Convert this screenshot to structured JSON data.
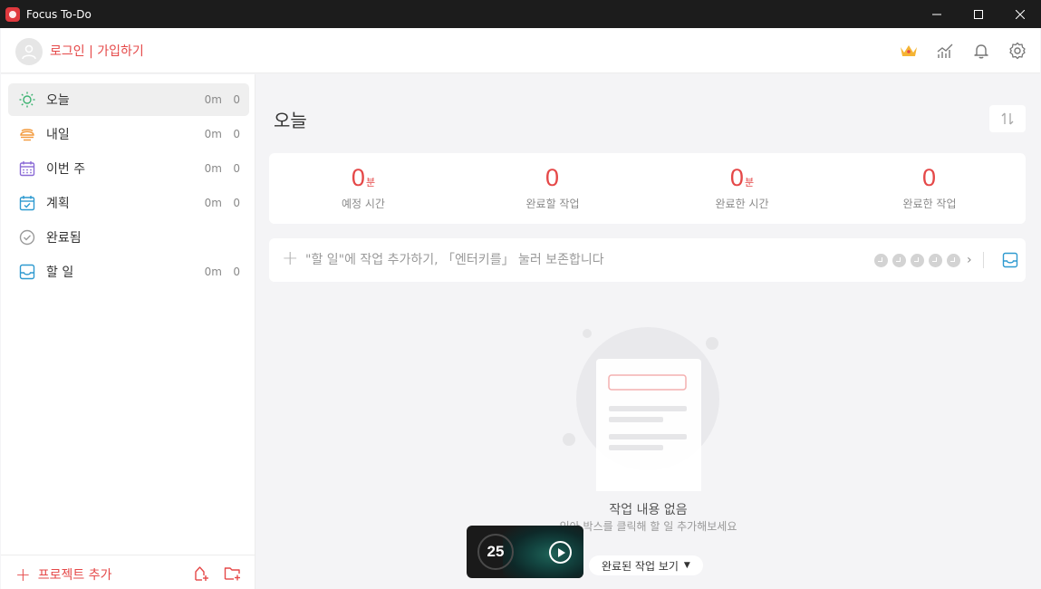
{
  "window": {
    "title": "Focus To-Do"
  },
  "header": {
    "login_label": "로그인 | 가입하기",
    "icons": [
      "crown-icon",
      "chart-icon",
      "bell-icon",
      "gear-icon"
    ]
  },
  "sidebar": {
    "items": [
      {
        "label": "오늘",
        "time": "0m",
        "count": "0",
        "icon": "sun-icon",
        "color": "#3cb371",
        "active": true
      },
      {
        "label": "내일",
        "time": "0m",
        "count": "0",
        "icon": "sunset-icon",
        "color": "#f39a3c",
        "active": false
      },
      {
        "label": "이번 주",
        "time": "0m",
        "count": "0",
        "icon": "calendar-week-icon",
        "color": "#8a6ad6",
        "active": false
      },
      {
        "label": "계획",
        "time": "0m",
        "count": "0",
        "icon": "calendar-check-icon",
        "color": "#2e9ad0",
        "active": false
      },
      {
        "label": "완료됨",
        "time": "",
        "count": "",
        "icon": "check-circle-icon",
        "color": "#9a9a9a",
        "active": false
      },
      {
        "label": "할 일",
        "time": "0m",
        "count": "0",
        "icon": "inbox-icon",
        "color": "#2e9ad0",
        "active": false
      }
    ],
    "footer": {
      "add_project_label": "프로젝트 추가"
    }
  },
  "main": {
    "title": "오늘",
    "stats": [
      {
        "value": "0",
        "unit": "분",
        "label": "예정 시간"
      },
      {
        "value": "0",
        "unit": "",
        "label": "완료할 작업"
      },
      {
        "value": "0",
        "unit": "분",
        "label": "완료한 시간"
      },
      {
        "value": "0",
        "unit": "",
        "label": "완료한 작업"
      }
    ],
    "add_task": {
      "placeholder": "\"할 일\"에 작업 추가하기, 「엔터키를」 눌러 보존합니다",
      "pomodoro_count": 5
    },
    "empty": {
      "title": "작업 내용 없음",
      "subtitle": "인아 박스를 클릭해 할 일 추가해보세요"
    },
    "show_completed_label": "완료된 작업 보기"
  },
  "timer": {
    "minutes": "25"
  },
  "colors": {
    "accent": "#e54848",
    "titlebar": "#1c1c1c",
    "background": "#f4f4f6"
  }
}
